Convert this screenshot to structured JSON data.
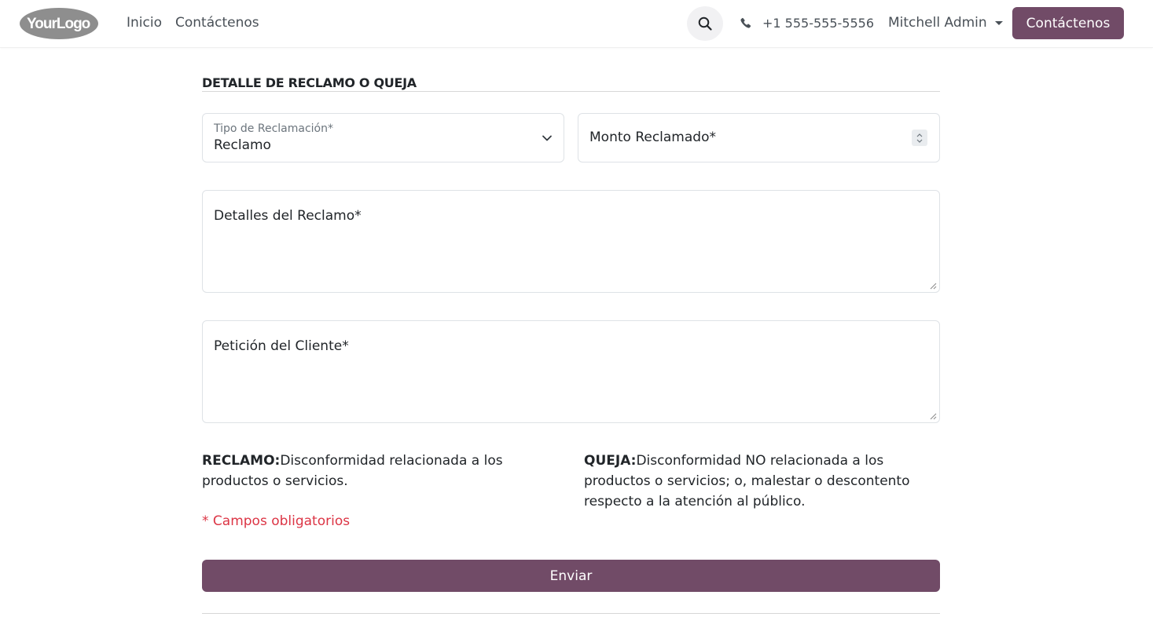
{
  "header": {
    "logo_text": "YourLogo",
    "nav": [
      {
        "label": "Inicio"
      },
      {
        "label": "Contáctenos"
      }
    ],
    "phone": "+1 555-555-5556",
    "user": "Mitchell Admin",
    "cta_label": "Contáctenos"
  },
  "form": {
    "section_title": "DETALLE DE RECLAMO O QUEJA",
    "claim_type": {
      "label": "Tipo de Reclamación*",
      "value": "Reclamo"
    },
    "amount": {
      "placeholder": "Monto Reclamado*"
    },
    "details": {
      "placeholder": "Detalles del Reclamo*"
    },
    "request": {
      "placeholder": "Petición del Cliente*"
    },
    "reclamo_term": "RECLAMO:",
    "reclamo_desc": "Disconformidad relacionada a los productos o servicios.",
    "queja_term": "QUEJA:",
    "queja_desc": "Disconformidad NO relacionada a los productos o servicios; o, malestar o descontento respecto a la atención al público.",
    "required_note": "* Campos obligatorios",
    "submit_label": "Enviar"
  },
  "colors": {
    "primary": "#714b67",
    "danger": "#dc3545",
    "text": "#212529",
    "muted": "#6c757d"
  }
}
